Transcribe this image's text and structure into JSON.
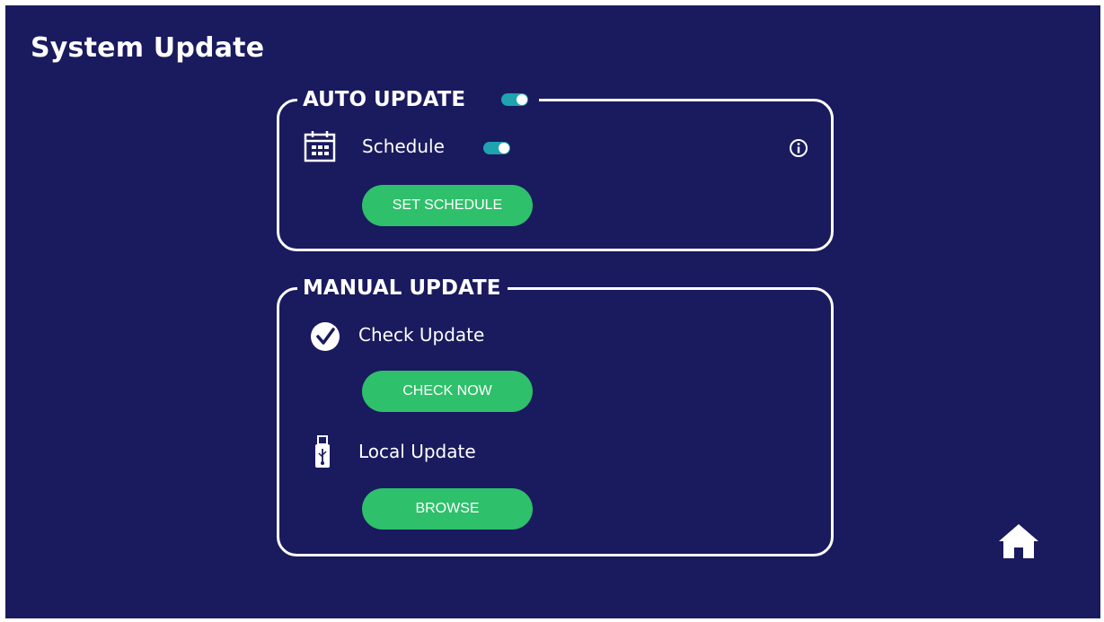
{
  "page": {
    "title": "System Update"
  },
  "auto_update": {
    "heading": "AUTO UPDATE",
    "enabled": true,
    "schedule": {
      "label": "Schedule",
      "enabled": true,
      "icon": "calendar-icon"
    },
    "info_icon": "info-icon",
    "set_schedule_label": "SET SCHEDULE"
  },
  "manual_update": {
    "heading": "MANUAL UPDATE",
    "check": {
      "label": "Check Update",
      "icon": "check-circle-icon",
      "button_label": "CHECK NOW"
    },
    "local": {
      "label": "Local Update",
      "icon": "usb-drive-icon",
      "button_label": "BROWSE"
    }
  },
  "nav": {
    "home_icon": "home-icon"
  },
  "colors": {
    "background": "#1a1a5e",
    "toggle_on": "#1fa3b0",
    "button": "#2ec06a",
    "text": "#ffffff"
  }
}
